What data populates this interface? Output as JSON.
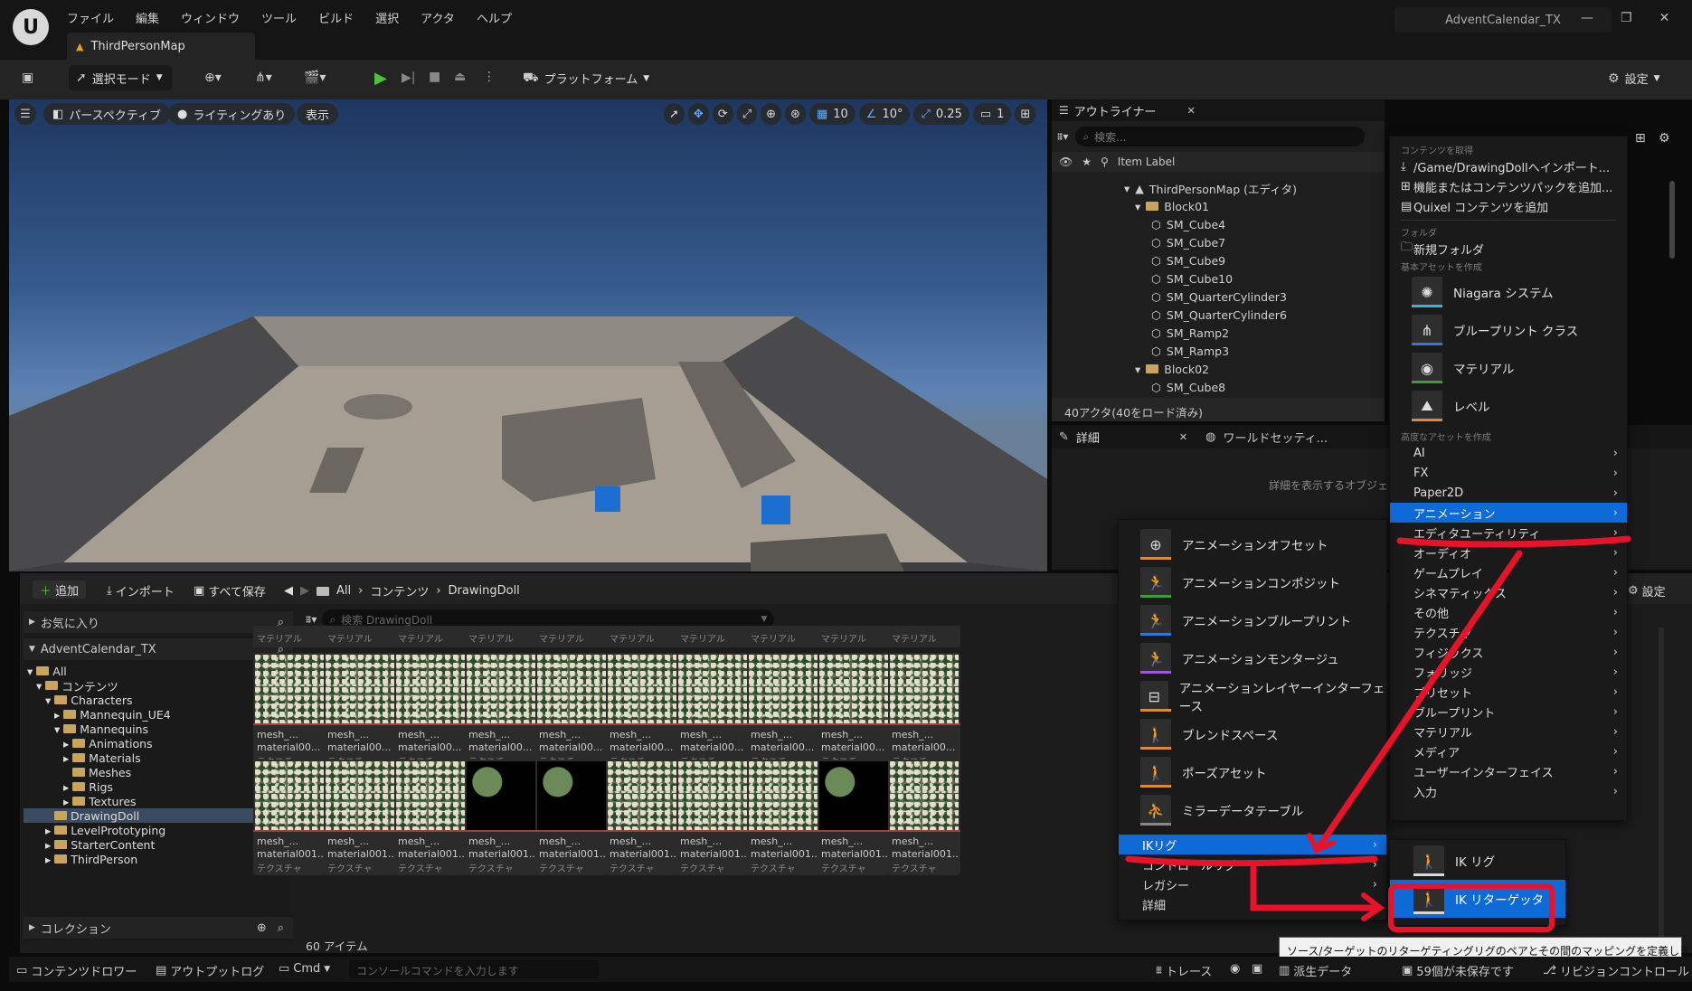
{
  "app": {
    "menu": [
      "ファイル",
      "編集",
      "ウィンドウ",
      "ツール",
      "ビルド",
      "選択",
      "アクタ",
      "ヘルプ"
    ],
    "project_name": "AdventCalendar_TX",
    "map_tab": "ThirdPersonMap",
    "logo_text": "U"
  },
  "toolbar": {
    "select_mode": "選択モード",
    "platform": "プラットフォーム",
    "settings": "設定"
  },
  "viewport": {
    "perspective": "パースペクティブ",
    "lighting": "ライティングあり",
    "show": "表示",
    "grid_snap": "10",
    "rot_snap": "10°",
    "scale_snap": "0.25",
    "cam_speed": "1"
  },
  "outliner": {
    "tab": "アウトライナー",
    "search_placeholder": "検索...",
    "column": "Item Label",
    "rows": [
      "ThirdPersonMap (エディタ)",
      "Block01",
      "SM_Cube4",
      "SM_Cube7",
      "SM_Cube9",
      "SM_Cube10",
      "SM_QuarterCylinder3",
      "SM_QuarterCylinder6",
      "SM_Ramp2",
      "SM_Ramp3",
      "Block02",
      "SM_Cube8"
    ],
    "count": "40アクタ(40をロード済み)"
  },
  "details": {
    "tab": "詳細",
    "world_tab": "ワールドセッティ...",
    "hint": "詳細を表示するオブジェクト"
  },
  "content_browser": {
    "add": "追加",
    "import": "インポート",
    "save_all": "すべて保存",
    "breadcrumb": [
      "All",
      "コンテンツ",
      "DrawingDoll"
    ],
    "settings": "設定",
    "favorites": "お気に入り",
    "project": "AdventCalendar_TX",
    "tree": [
      "All",
      "コンテンツ",
      "Characters",
      "Mannequin_UE4",
      "Mannequins",
      "Animations",
      "Materials",
      "Meshes",
      "Rigs",
      "Textures",
      "DrawingDoll",
      "LevelPrototyping",
      "StarterContent",
      "ThirdPerson"
    ],
    "collections": "コレクション",
    "search_placeholder": "検索 DrawingDoll",
    "header_label": "マテリアル",
    "tile_name": "mesh_...",
    "tile_sub_row1": "material00...",
    "tile_sub_row2": "material001...",
    "tile_type": "テクスチャ",
    "item_count": "60 アイテム"
  },
  "add_menu": {
    "sec_get": "コンテンツを取得",
    "import_to": "/Game/DrawingDollへインポート...",
    "add_feature": "機能またはコンテンツパックを追加...",
    "quixel": "Quixel コンテンツを追加",
    "sec_folder": "フォルダ",
    "new_folder": "新規フォルダ",
    "sec_basic": "基本アセットを作成",
    "basic": [
      "Niagara システム",
      "ブループリント クラス",
      "マテリアル",
      "レベル"
    ],
    "sec_adv": "高度なアセットを作成",
    "adv": [
      "AI",
      "FX",
      "Paper2D",
      "アニメーション",
      "エディタユーティリティ",
      "オーディオ",
      "ゲームプレイ",
      "シネマティックス",
      "その他",
      "テクスチャ",
      "フィジックス",
      "フォリッジ",
      "プリセット",
      "ブループリント",
      "マテリアル",
      "メディア",
      "ユーザーインターフェイス",
      "入力"
    ]
  },
  "anim_menu": {
    "items": [
      "アニメーションオフセット",
      "アニメーションコンポジット",
      "アニメーションブループリント",
      "アニメーションモンタージュ",
      "アニメーションレイヤーインターフェース",
      "ブレンドスペース",
      "ポーズアセット",
      "ミラーデータテーブル"
    ],
    "sub": [
      "IKリグ",
      "コントロールリグ",
      "レガシー",
      "詳細"
    ]
  },
  "ik_menu": {
    "items": [
      "IK リグ",
      "IK リターゲッタ"
    ]
  },
  "tooltip": "ソース/ターゲットのリターゲティングリグのペアとその間のマッピングを定義します。",
  "status": {
    "drawer": "コンテンツドロワー",
    "output": "アウトプットログ",
    "cmd": "Cmd",
    "console_placeholder": "コンソールコマンドを入力します",
    "trace": "トレース",
    "derived": "派生データ",
    "unsaved": "59個が未保存です",
    "revision": "リビジョンコントロール"
  },
  "colors": {
    "accent": "#0e6ad6",
    "annotation": "#e8132a",
    "folder": "#c9a45c"
  }
}
